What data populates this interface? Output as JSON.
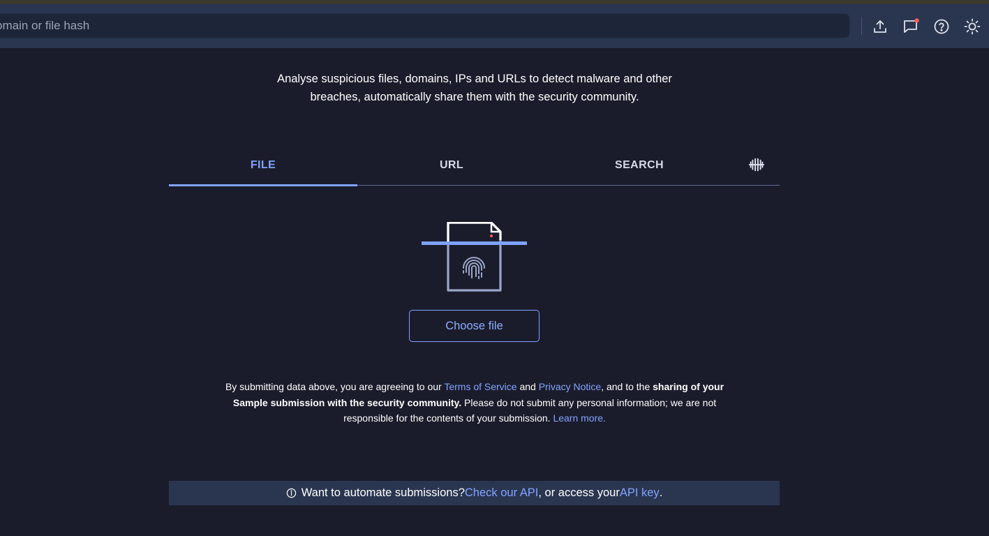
{
  "header": {
    "search_placeholder": "omain or file hash",
    "icons": [
      "upload-icon",
      "chat-icon",
      "help-icon",
      "theme-icon"
    ],
    "notification_dot_color": "#ff5a5a"
  },
  "tagline": {
    "line1": "Analyse suspicious files, domains, IPs and URLs to detect malware and other",
    "line2": "breaches, automatically share them with the security community."
  },
  "tabs": [
    {
      "label": "FILE",
      "active": true
    },
    {
      "label": "URL",
      "active": false
    },
    {
      "label": "SEARCH",
      "active": false
    }
  ],
  "tab_extra_icon": "vt-collections-icon",
  "upload": {
    "choose_label": "Choose file"
  },
  "legal": {
    "part1": "By submitting data above, you are agreeing to our ",
    "tos_link": "Terms of Service",
    "part2": " and ",
    "privacy_link": "Privacy Notice",
    "part3": ", and to the ",
    "bold": "sharing of your Sample submission with the security community.",
    "part4": " Please do not submit any personal information; we are not responsible for the contents of your submission. ",
    "learn_link": "Learn more."
  },
  "api_bar": {
    "text1": "Want to automate submissions? ",
    "api_link": "Check our API",
    "text2": ", or access your ",
    "key_link": "API key",
    "text3": "."
  },
  "colors": {
    "background": "#1b1c2b",
    "header": "#2a3550",
    "accent": "#7fa2ff"
  }
}
